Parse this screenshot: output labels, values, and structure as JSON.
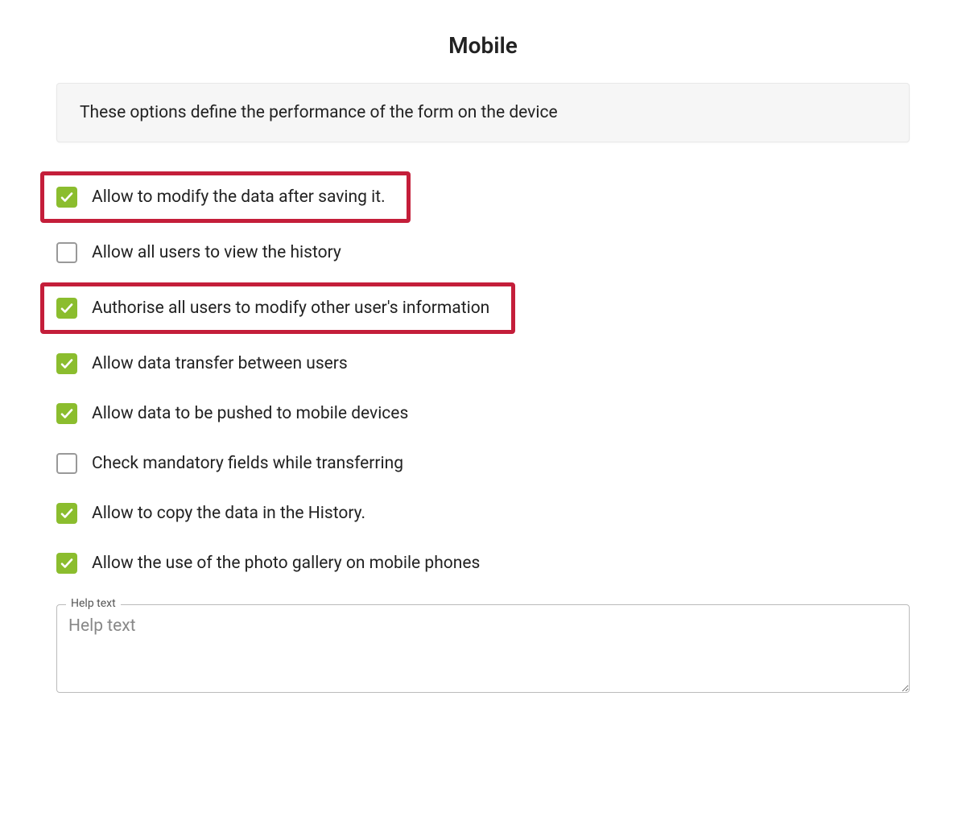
{
  "title": "Mobile",
  "info_text": "These options define the performance of the form on the device",
  "options": [
    {
      "label": "Allow to modify the data after saving it.",
      "checked": true,
      "highlighted": true,
      "hclass": "highlight-wrap-1",
      "name": "option-allow-modify-after-save"
    },
    {
      "label": "Allow all users to view the history",
      "checked": false,
      "highlighted": false,
      "hclass": "",
      "name": "option-allow-view-history"
    },
    {
      "label": "Authorise all users to modify other user's information",
      "checked": true,
      "highlighted": true,
      "hclass": "highlight-wrap-2",
      "name": "option-authorise-modify-others"
    },
    {
      "label": "Allow data transfer between users",
      "checked": true,
      "highlighted": false,
      "hclass": "",
      "name": "option-allow-data-transfer"
    },
    {
      "label": "Allow data to be pushed to mobile devices",
      "checked": true,
      "highlighted": false,
      "hclass": "",
      "name": "option-allow-push-mobile"
    },
    {
      "label": "Check mandatory fields while transferring",
      "checked": false,
      "highlighted": false,
      "hclass": "",
      "name": "option-check-mandatory-transfer"
    },
    {
      "label": "Allow to copy the data in the History.",
      "checked": true,
      "highlighted": false,
      "hclass": "",
      "name": "option-allow-copy-history"
    },
    {
      "label": "Allow the use of the photo gallery on mobile phones",
      "checked": true,
      "highlighted": false,
      "hclass": "",
      "name": "option-allow-photo-gallery"
    }
  ],
  "help": {
    "legend": "Help text",
    "placeholder": "Help text",
    "value": ""
  }
}
